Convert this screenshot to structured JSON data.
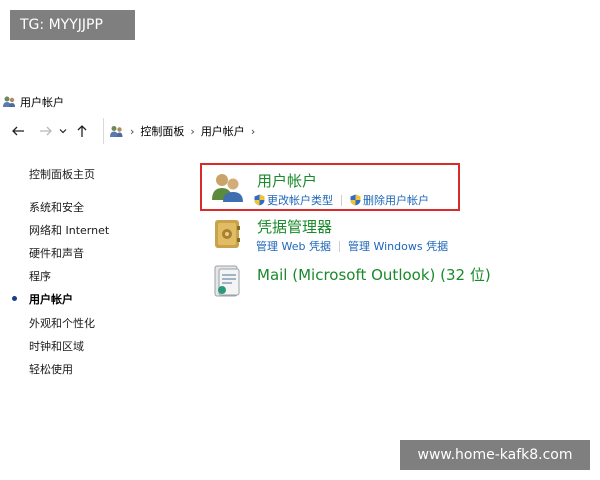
{
  "tag": "TG: MYYJJPP",
  "window": {
    "title": "用户帐户",
    "title_icon": "user-accounts-icon"
  },
  "nav": {
    "back_icon": "arrow-left-icon",
    "forward_icon": "arrow-right-icon",
    "recent_icon": "chevron-down-icon",
    "up_icon": "arrow-up-icon"
  },
  "address": {
    "crumbs": [
      "控制面板",
      "用户帐户"
    ]
  },
  "sidebar": {
    "home": "控制面板主页",
    "items": [
      "系统和安全",
      "网络和 Internet",
      "硬件和声音",
      "程序",
      "用户帐户",
      "外观和个性化",
      "时钟和区域",
      "轻松使用"
    ],
    "active": "用户帐户"
  },
  "categories": [
    {
      "title": "用户帐户",
      "icon": "user-accounts-icon",
      "links": [
        "更改帐户类型",
        "删除用户帐户"
      ],
      "links_shield": true
    },
    {
      "title": "凭据管理器",
      "icon": "credential-vault-icon",
      "links": [
        "管理 Web 凭据",
        "管理 Windows 凭据"
      ],
      "links_shield": false
    },
    {
      "title": "Mail (Microsoft Outlook) (32 位)",
      "icon": "mail-icon",
      "links": [],
      "links_shield": false
    }
  ],
  "colors": {
    "category_title": "#1a8a2a",
    "link": "#1e66b8",
    "highlight_border": "#d92b2b"
  },
  "watermark": "www.home-kafk8.com"
}
